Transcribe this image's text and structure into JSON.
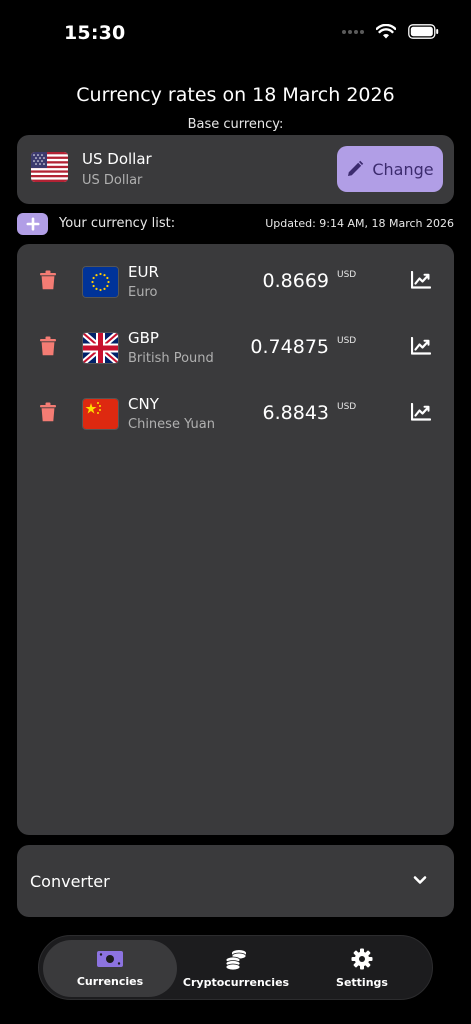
{
  "status_bar": {
    "time": "15:30"
  },
  "header": {
    "title": "Currency rates on 18 March 2026",
    "base_label": "Base currency:"
  },
  "base_currency": {
    "code": "US Dollar",
    "name": "US Dollar",
    "flag_icon": "us-flag-icon",
    "change_label": "Change"
  },
  "list_header": {
    "label": "Your currency list:",
    "updated": "Updated: 9:14 AM, 18 March 2026"
  },
  "currencies": [
    {
      "code": "EUR",
      "name": "Euro",
      "rate": "0.8669",
      "unit": "USD",
      "flag_icon": "eu-flag-icon"
    },
    {
      "code": "GBP",
      "name": "British Pound",
      "rate": "0.74875",
      "unit": "USD",
      "flag_icon": "uk-flag-icon"
    },
    {
      "code": "CNY",
      "name": "Chinese Yuan",
      "rate": "6.8843",
      "unit": "USD",
      "flag_icon": "china-flag-icon"
    }
  ],
  "converter": {
    "label": "Converter"
  },
  "tabs": [
    {
      "label": "Currencies",
      "icon": "banknote-icon",
      "active": true
    },
    {
      "label": "Cryptocurrencies",
      "icon": "coins-icon",
      "active": false
    },
    {
      "label": "Settings",
      "icon": "gear-icon",
      "active": false
    }
  ],
  "colors": {
    "accent": "#b19ee6",
    "card": "#3a3a3c",
    "trash": "#f47c74",
    "background": "#000000"
  }
}
